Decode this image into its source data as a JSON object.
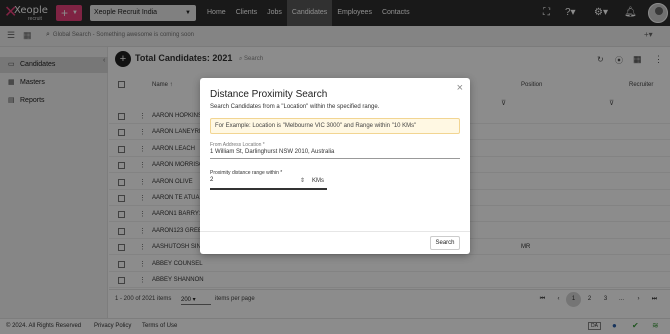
{
  "topbar": {
    "logo_word": "Xeople",
    "logo_sub": "recruit",
    "add_label": "+",
    "org_name": "Xeople Recruit India",
    "nav": [
      "Home",
      "Clients",
      "Jobs",
      "Candidates",
      "Employees",
      "Contacts"
    ],
    "active_nav": "Candidates",
    "icons": [
      "fullscreen-icon",
      "help-icon",
      "settings-icon",
      "bell-icon",
      "avatar"
    ]
  },
  "global_search": {
    "placeholder": "Global Search - Something awesome is coming soon"
  },
  "sidebar": {
    "items": [
      {
        "label": "Candidates",
        "icon": "folder-icon"
      },
      {
        "label": "Masters",
        "icon": "grid-icon"
      },
      {
        "label": "Reports",
        "icon": "chart-icon"
      }
    ]
  },
  "main": {
    "total_label": "Total Candidates: 2021",
    "search_placeholder": "Search",
    "columns": {
      "name": "Name",
      "position": "Position",
      "recruiter": "Recruiter"
    },
    "rows": [
      {
        "name": "AARON HOPKINS",
        "position": ""
      },
      {
        "name": "AARON LANEYRE",
        "position": ""
      },
      {
        "name": "AARON LEACH",
        "position": ""
      },
      {
        "name": "AARON MORRISO",
        "position": ""
      },
      {
        "name": "AARON OLIVE",
        "position": ""
      },
      {
        "name": "AARON TE ATUA",
        "position": ""
      },
      {
        "name": "AARON1 BARRY1",
        "position": ""
      },
      {
        "name": "AARON123 GREE",
        "position": ""
      },
      {
        "name": "AASHUTOSH SIN",
        "position": "MR"
      },
      {
        "name": "ABBEY COUNSEL",
        "position": ""
      },
      {
        "name": "ABBEY SHANNON",
        "position": ""
      },
      {
        "name": "ABBIE BIALIO",
        "position": ""
      }
    ],
    "pagination": {
      "range": "1 - 200 of 2021 items",
      "per_page": "200",
      "per_page_label": "items per page",
      "pages": [
        "1",
        "2",
        "3",
        "..."
      ],
      "active_page": "1"
    }
  },
  "status_bar": {
    "copyright": "© 2024. All Rights Reserved",
    "privacy": "Privacy Policy",
    "terms": "Terms of Use",
    "badge": "DA"
  },
  "modal": {
    "title": "Distance Proximity Search",
    "description": "Search Candidates from a \"Location\" within the specified range.",
    "hint": "For Example: Location is \"Melbourne VIC 3000\" and Range within \"10 KMs\"",
    "from_label": "From Address Location *",
    "from_value": "1 William St, Darlinghurst NSW 2010, Australia",
    "range_label": "Proximity distance range within *",
    "range_value": "2",
    "range_unit": "KMs",
    "search_label": "Search"
  }
}
